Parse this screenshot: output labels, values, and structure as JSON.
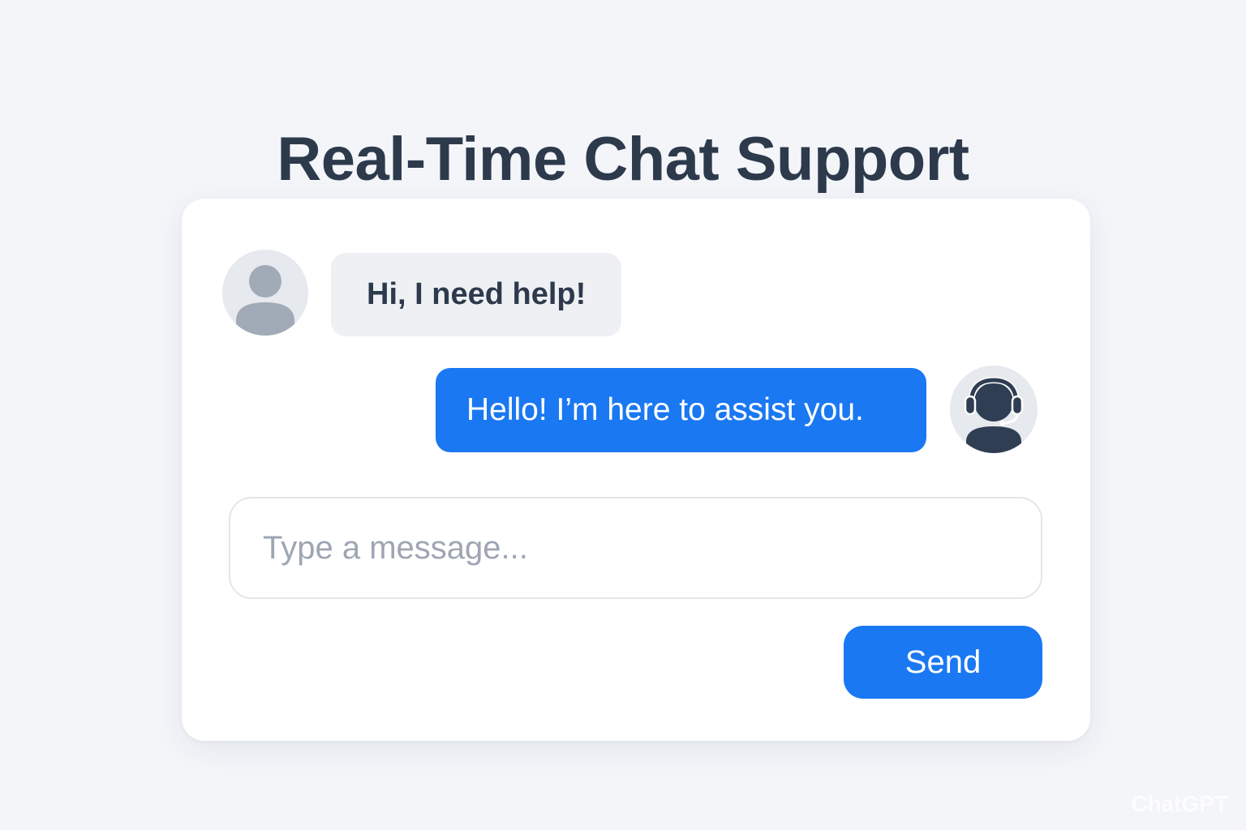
{
  "page": {
    "title": "Real-Time Chat Support"
  },
  "chat": {
    "messages": [
      {
        "sender": "user",
        "avatar_icon": "user-silhouette-icon",
        "text": "Hi, I need help!"
      },
      {
        "sender": "agent",
        "avatar_icon": "headset-agent-icon",
        "text": "Hello! I’m here to assist you."
      }
    ]
  },
  "composer": {
    "placeholder": "Type a message...",
    "value": "",
    "send_label": "Send"
  },
  "watermark": "ChatGPT",
  "colors": {
    "background": "#f3f5f9",
    "card": "#ffffff",
    "accent": "#1a78f2",
    "title_text": "#2d3a4c",
    "incoming_bubble": "#eef0f4",
    "placeholder_text": "#9ea6b3",
    "avatar_bg": "#e6e9ee"
  }
}
